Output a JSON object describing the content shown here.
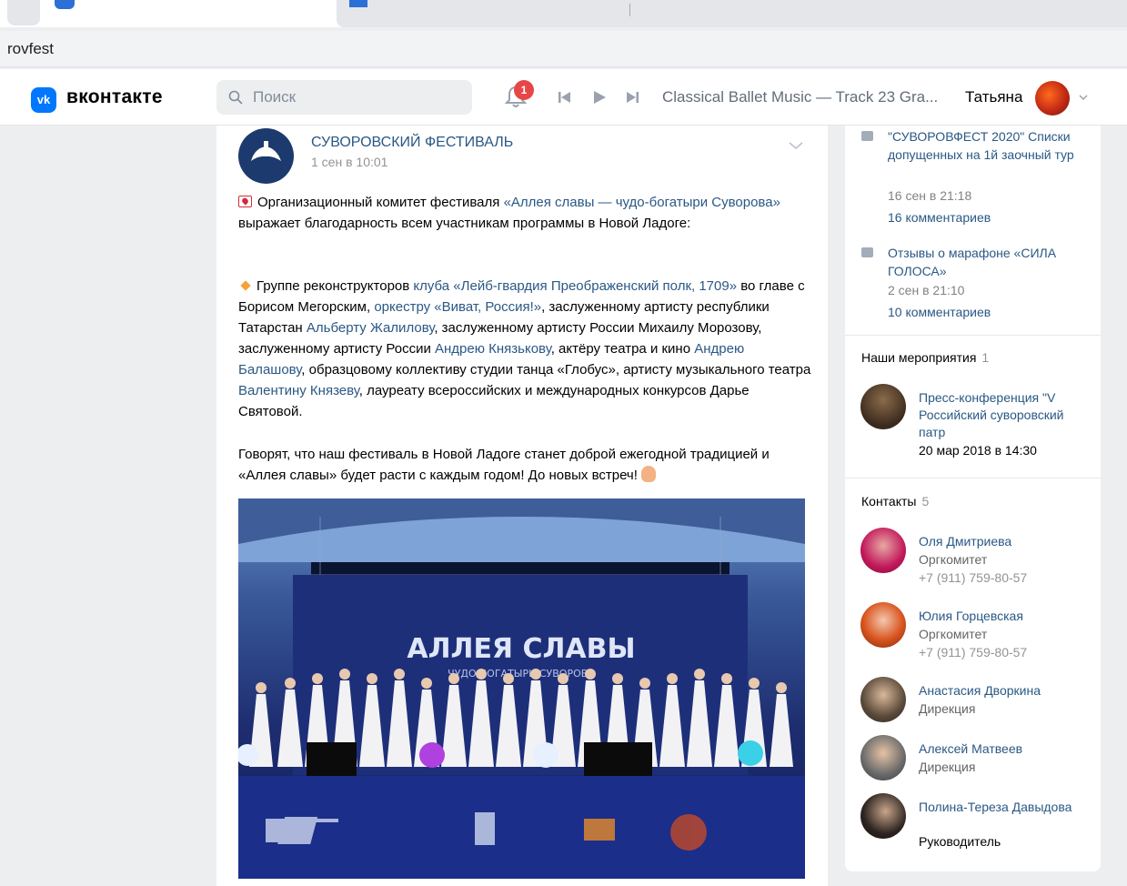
{
  "browser": {
    "url": "rovfest"
  },
  "header": {
    "logo_text": "вконтакте",
    "logo_mark": "vk",
    "search_placeholder": "Поиск",
    "notification_count": "1",
    "track": "Classical Ballet Music — Track 23 Gra...",
    "user_name": "Татьяна",
    "icons": [
      "search-icon",
      "bell-icon",
      "prev-track-icon",
      "play-icon",
      "next-track-icon",
      "chevron-down-icon"
    ]
  },
  "post": {
    "group_name": "СУВОРОВСКИЙ ФЕСТИВАЛЬ",
    "date": "1 сен в 10:01",
    "p1": {
      "t1": "Организационный комитет фестиваля ",
      "l1": "«Аллея славы — чудо-богатыри Суворова»",
      "t2": " выражает благодарность всем участникам программы в Новой Ладоге:"
    },
    "p2": {
      "t1": "Группе реконструкторов ",
      "l1": "клуба «Лейб-гвардия Преображенский полк, 1709»",
      "t2": " во главе с Борисом Мегорским, ",
      "l2": "оркестру «Виват, Россия!»",
      "t3": ", заслуженному артисту республики Татарстан ",
      "l3": "Альберту Жалилову",
      "t4": ", заслуженному артисту России Михаилу Морозову, заслуженному артисту России ",
      "l4": "Андрею Князькову",
      "t5": ", актёру театра и кино ",
      "l5": "Андрею Балашову",
      "t6": ", образцовому коллективу студии танца «Глобус», артисту музыкального театра ",
      "l6": "Валентину Князеву",
      "t7": ", лауреату всероссийских и международных конкурсов Дарье Святовой."
    },
    "p3": "Говорят, что наш фестиваль в Новой Ладоге станет доброй ежегодной традицией и «Аллея славы» будет расти с каждым годом! До новых встреч!",
    "photo": {
      "banner_title": "АЛЛЕЯ СЛАВЫ",
      "banner_subtitle": "ЧУДО-БОГАТЫРИ СУВОРОВА"
    }
  },
  "sidebar": {
    "discussions": [
      {
        "title": "\"СУВОРОВФЕСТ 2020\" Списки допущенных на 1й заочный тур",
        "date": "16 сен в 21:18",
        "comments": "16 комментариев"
      },
      {
        "title": "Отзывы о марафоне «СИЛА ГОЛОСА»",
        "date": "2 сен в 21:10",
        "comments": "10 комментариев"
      }
    ],
    "events": {
      "title": "Наши мероприятия",
      "count": "1",
      "item": {
        "title": "Пресс-конференция \"V Российский суворовский патр",
        "date": "20 мар 2018 в 14:30"
      }
    },
    "contacts": {
      "title": "Контакты",
      "count": "5",
      "items": [
        {
          "name": "Оля Дмитриева",
          "role": "Оргкомитет",
          "phone": "+7 (911) 759-80-57"
        },
        {
          "name": "Юлия Горцевская",
          "role": "Оргкомитет",
          "phone": "+7 (911) 759-80-57"
        },
        {
          "name": "Анастасия Дворкина",
          "role": "Дирекция"
        },
        {
          "name": "Алексей Матвеев",
          "role": "Дирекция"
        },
        {
          "name": "Полина-Тереза Давыдова",
          "role": "Руководитель"
        }
      ]
    }
  },
  "colors": {
    "vk_blue": "#0077ff",
    "link": "#2a5885",
    "badge": "#e64646",
    "page_bg": "#edeef0"
  }
}
